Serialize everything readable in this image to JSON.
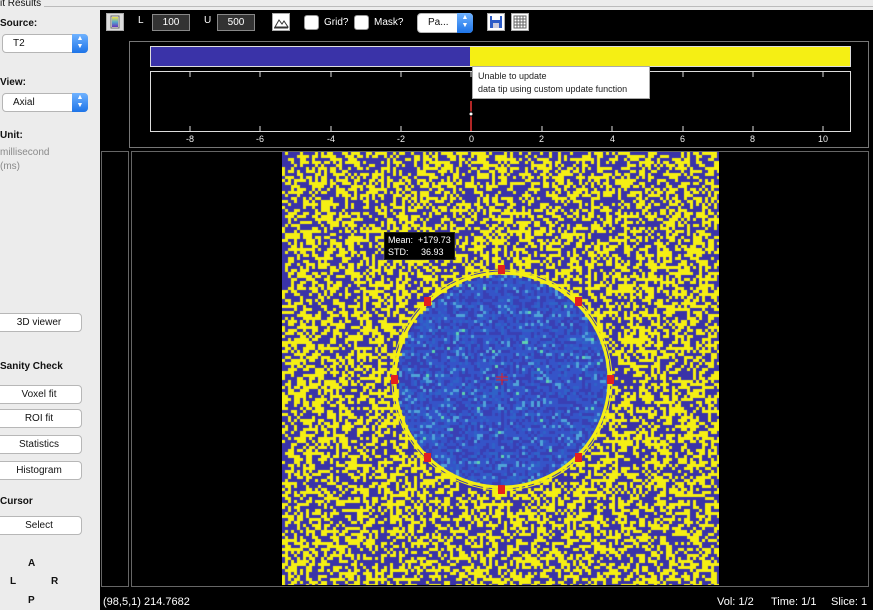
{
  "panel": {
    "legend": "it Results",
    "source_label": "Source:",
    "source_value": "T2",
    "view_label": "View:",
    "view_value": "Axial",
    "unit_label": "Unit:",
    "unit_line1": "millisecond",
    "unit_line2": "(ms)",
    "viewer3d_label": "3D viewer",
    "sanity_label": "Sanity Check",
    "voxel_fit": "Voxel fit",
    "roi_fit": "ROI fit",
    "statistics": "Statistics",
    "histogram": "Histogram",
    "cursor_label": "Cursor",
    "select": "Select",
    "orient": {
      "a": "A",
      "l": "L",
      "r": "R",
      "p": "P"
    }
  },
  "toolbar": {
    "l_label": "L",
    "l_value": "100",
    "u_label": "U",
    "u_value": "500",
    "grid_label": "Grid?",
    "mask_label": "Mask?",
    "popup_value": "Pa..."
  },
  "colorbar": {
    "ticks": [
      "-8",
      "-6",
      "-4",
      "-2",
      "0",
      "2",
      "4",
      "6",
      "8",
      "10"
    ],
    "tooltip_line1": "Unable to update",
    "tooltip_line2": "data tip using custom update function",
    "low_color": "#3a33a8",
    "high_color": "#f5ef14"
  },
  "roi": {
    "mean_line": "Mean:  +179.73",
    "std_line": "STD:     36.93"
  },
  "status": {
    "readout": "(98,5,1) 214.7682",
    "vol": "Vol: 1/2",
    "time": "Time: 1/1",
    "slice": "Slice: 1"
  }
}
